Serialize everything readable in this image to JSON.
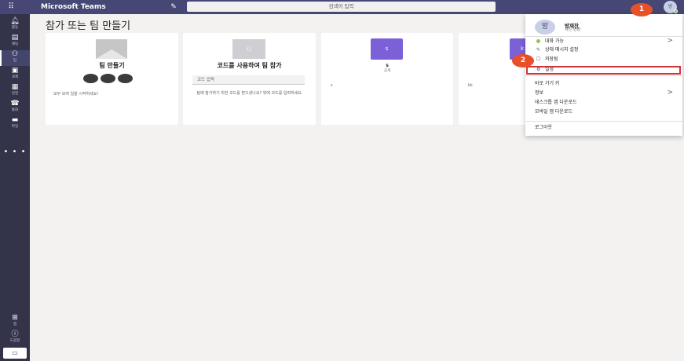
{
  "header": {
    "app_title": "Microsoft Teams",
    "search_placeholder": "검색어 입력",
    "avatar_initial": "방",
    "brand_color": "#464775"
  },
  "rail": {
    "items": [
      {
        "label": "활동",
        "icon": "bell-icon"
      },
      {
        "label": "채팅",
        "icon": "chat-icon"
      },
      {
        "label": "팀",
        "icon": "teams-icon"
      },
      {
        "label": "과제",
        "icon": "assignments-icon"
      },
      {
        "label": "일정",
        "icon": "calendar-icon"
      },
      {
        "label": "통화",
        "icon": "phone-icon"
      },
      {
        "label": "파일",
        "icon": "files-icon"
      }
    ],
    "more": "• • •",
    "apps_label": "앱",
    "help_label": "도움말"
  },
  "main": {
    "title": "참가 또는 팀 만들기",
    "create_card": {
      "title": "팀 만들기",
      "description": "모두 모여 일을 시작하세요!"
    },
    "code_card": {
      "title": "코드를 사용하여 팀 참가",
      "input_placeholder": "코드 입력",
      "description": "팀에 참가하기 위한 코드를 받으셨나요? 위에 코드를 입력하세요."
    },
    "team_cards": [
      {
        "tile": "s",
        "name": "s",
        "type": "공개",
        "footer": "s"
      },
      {
        "tile": "k",
        "name": "",
        "type": "",
        "footer": "kk"
      }
    ],
    "team_tile_color": "#7b60d8"
  },
  "profile_menu": {
    "name": "방재찬",
    "change_photo": "사진 변경",
    "status": "대화 가능",
    "set_status": "상태 메시지 설정",
    "saved": "저장됨",
    "settings": "설정",
    "shortcuts": "바로 가기 키",
    "about": "정보",
    "desktop_download": "데스크톱 앱 다운로드",
    "mobile_download": "모바일 앱 다운로드",
    "logout": "로그아웃"
  },
  "annotations": {
    "step1": "1",
    "step2": "2",
    "highlight_color": "#d13438",
    "badge_color": "#e8502a"
  }
}
